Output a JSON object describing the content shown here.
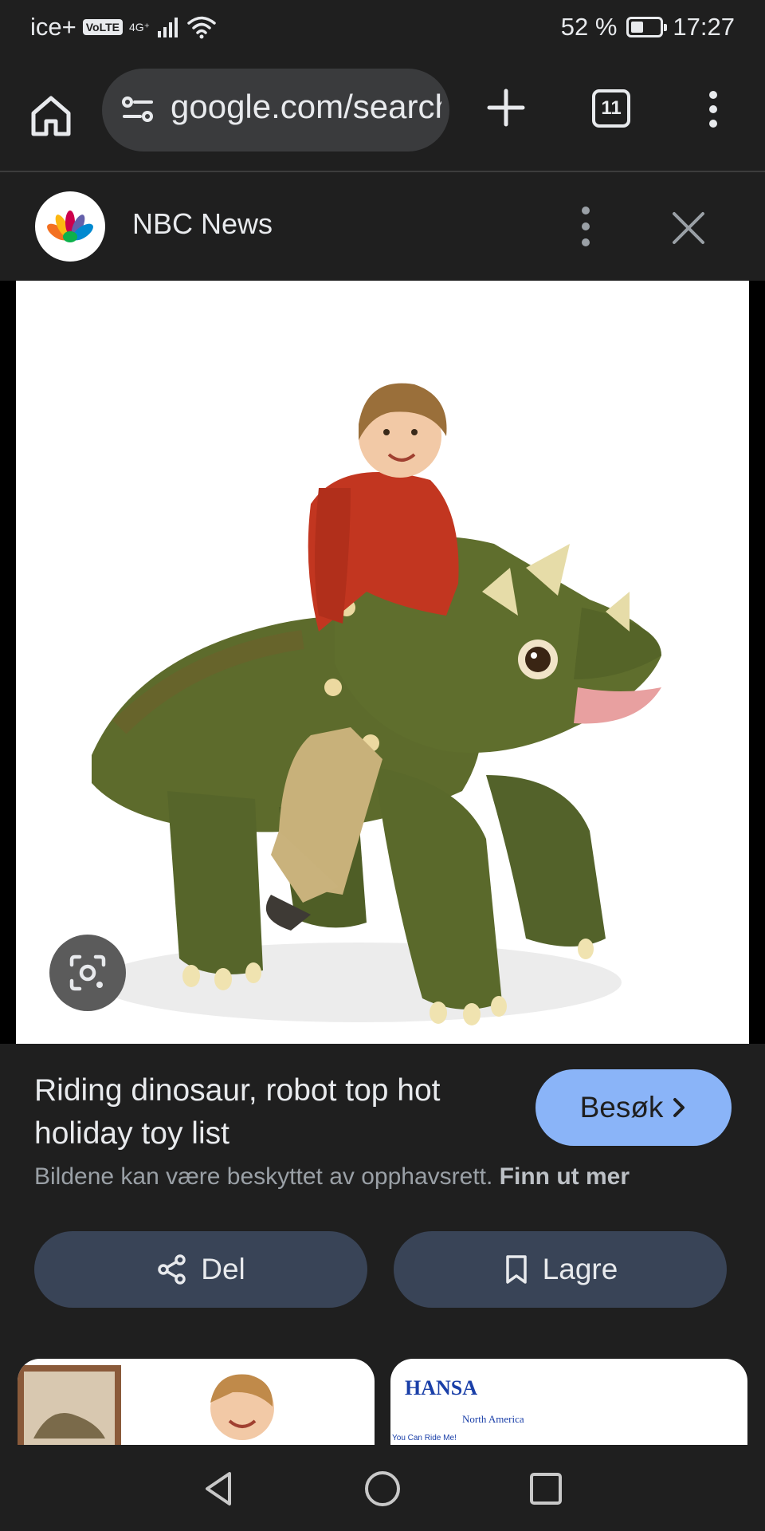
{
  "status_bar": {
    "carrier": "ice+",
    "volte": "VoLTE",
    "network": "4G⁺",
    "battery_percent_text": "52 %",
    "battery_level": 0.52,
    "time": "17:27"
  },
  "browser": {
    "url": "google.com/search",
    "tab_count": "11",
    "icons": {
      "home": "home-icon",
      "site_settings": "tune-icon",
      "new_tab": "plus-icon",
      "menu": "more-vert-icon"
    }
  },
  "source": {
    "name": "NBC News",
    "logo": "nbc-peacock-logo"
  },
  "result": {
    "title": "Riding dinosaur, robot top hot holiday toy list",
    "visit_label": "Besøk",
    "copyright_text": "Bildene kan være beskyttet av opphavsrett.",
    "learn_more": "Finn ut mer",
    "share_label": "Del",
    "save_label": "Lagre"
  },
  "related": {
    "thumb2_brand": "HANSA",
    "thumb2_sub": "North America",
    "thumb2_tag": "You Can Ride Me!"
  },
  "colors": {
    "background": "#1f1f1f",
    "accent_button": "#8ab4f8",
    "action_button": "#394457"
  }
}
